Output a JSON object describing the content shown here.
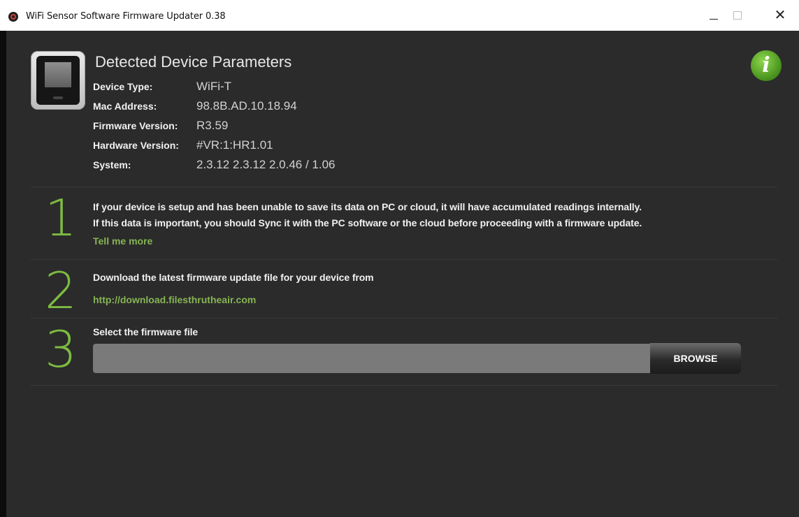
{
  "window": {
    "title": "WiFi Sensor Software Firmware Updater 0.38",
    "close_glyph": "✕"
  },
  "header": {
    "title": "Detected Device Parameters",
    "device_icon": "device-icon",
    "info_icon_glyph": "i",
    "params": [
      {
        "label": "Device Type:",
        "value": "WiFi-T"
      },
      {
        "label": "Mac Address:",
        "value": "98.8B.AD.10.18.94"
      },
      {
        "label": "Firmware Version:",
        "value": "R3.59"
      },
      {
        "label": "Hardware Version:",
        "value": "#VR:1:HR1.01"
      },
      {
        "label": "System:",
        "value": "2.3.12 2.3.12 2.0.46 / 1.06"
      }
    ]
  },
  "steps": [
    {
      "number": "1",
      "lines": [
        "If your device is setup and has been unable to save its data on PC or cloud, it will have accumulated readings internally.",
        "If this data is important, you should Sync it with the PC software or the cloud before proceeding with a firmware update."
      ],
      "link": "Tell me more"
    },
    {
      "number": "2",
      "lines": [
        "Download the latest firmware update file for your device from"
      ],
      "link": "http://download.filesthrutheair.com"
    },
    {
      "number": "3",
      "lines": [
        "Select the firmware file"
      ],
      "file_value": "",
      "browse_label": "BROWSE"
    }
  ],
  "colors": {
    "accent_green": "#7dbb42",
    "link_green": "#86b454",
    "background": "#2b2b2b"
  }
}
